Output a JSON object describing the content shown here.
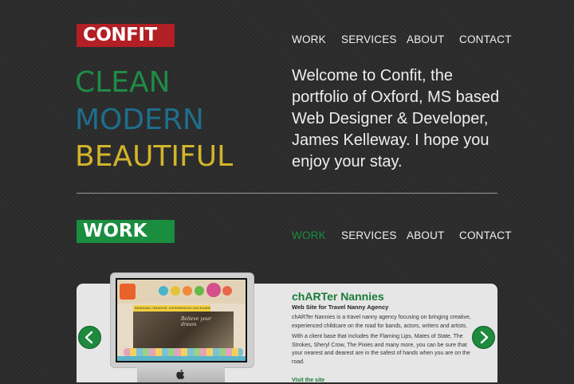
{
  "header": {
    "logo": "CONFIT",
    "nav": [
      "WORK",
      "SERVICES",
      "ABOUT",
      "CONTACT"
    ]
  },
  "hero": {
    "tagline": [
      "CLEAN",
      "MODERN",
      "BEAUTIFUL"
    ],
    "tagline_colors": [
      "#1e8c45",
      "#1e6e8c",
      "#d3b52a"
    ],
    "intro": "Welcome to Confit, the portfolio of Oxford, MS based Web Designer & Developer, James Kelleway. I hope you enjoy your stay."
  },
  "work": {
    "badge": "WORK",
    "nav": [
      "WORK",
      "SERVICES",
      "ABOUT",
      "CONTACT"
    ],
    "active_nav": "WORK",
    "project": {
      "title": "chARTer Nannies",
      "subtitle": "Web Site for Travel Nanny Agency",
      "description": [
        "chARTer Nannies is a travel nanny agency focusing on bringing creative, experienced childcare on the road for bands, actors, writers and artists.",
        "With a client base that includes the Flaming Lips, Mates of State, The Strokes, Sheryl Crow, The Pixies and many more, you can be sure that your nearest and dearest are in the safest of hands when you are on the road."
      ],
      "link": "Visit the site",
      "screenshot_text": {
        "banner": "BRINGING CREATIVE, EXPERIENCED CHILDCARE",
        "banner2": "ON THE ROAD",
        "script": "Believe your dream"
      }
    }
  },
  "colors": {
    "logo_bg": "#b21f24",
    "work_bg": "#1a8d3f",
    "accent_green": "#1a7a39"
  },
  "icons": [
    "left-arrow-icon",
    "right-arrow-icon",
    "apple-logo-icon"
  ]
}
